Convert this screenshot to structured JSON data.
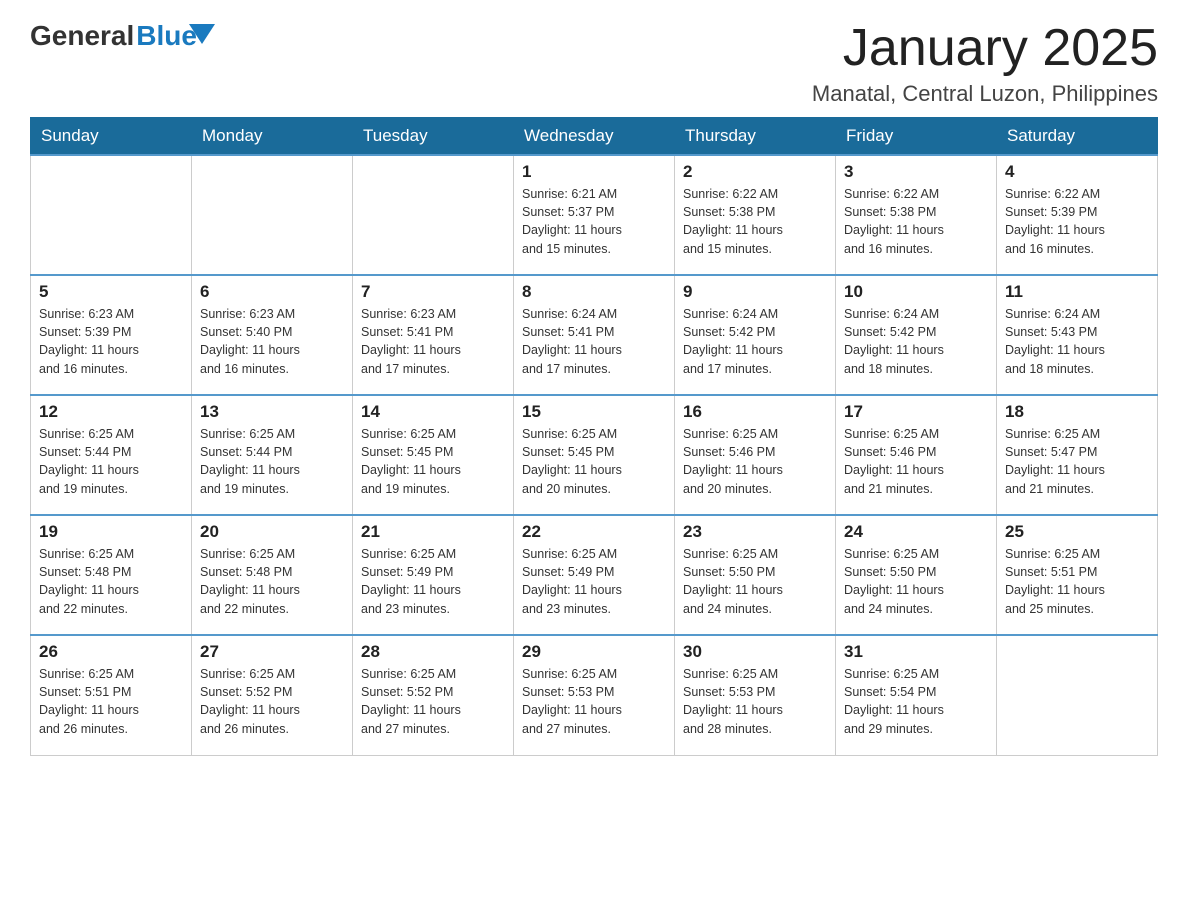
{
  "header": {
    "logo_general": "General",
    "logo_blue": "Blue",
    "month_title": "January 2025",
    "location": "Manatal, Central Luzon, Philippines"
  },
  "weekdays": [
    "Sunday",
    "Monday",
    "Tuesday",
    "Wednesday",
    "Thursday",
    "Friday",
    "Saturday"
  ],
  "weeks": [
    [
      {
        "day": "",
        "info": ""
      },
      {
        "day": "",
        "info": ""
      },
      {
        "day": "",
        "info": ""
      },
      {
        "day": "1",
        "info": "Sunrise: 6:21 AM\nSunset: 5:37 PM\nDaylight: 11 hours\nand 15 minutes."
      },
      {
        "day": "2",
        "info": "Sunrise: 6:22 AM\nSunset: 5:38 PM\nDaylight: 11 hours\nand 15 minutes."
      },
      {
        "day": "3",
        "info": "Sunrise: 6:22 AM\nSunset: 5:38 PM\nDaylight: 11 hours\nand 16 minutes."
      },
      {
        "day": "4",
        "info": "Sunrise: 6:22 AM\nSunset: 5:39 PM\nDaylight: 11 hours\nand 16 minutes."
      }
    ],
    [
      {
        "day": "5",
        "info": "Sunrise: 6:23 AM\nSunset: 5:39 PM\nDaylight: 11 hours\nand 16 minutes."
      },
      {
        "day": "6",
        "info": "Sunrise: 6:23 AM\nSunset: 5:40 PM\nDaylight: 11 hours\nand 16 minutes."
      },
      {
        "day": "7",
        "info": "Sunrise: 6:23 AM\nSunset: 5:41 PM\nDaylight: 11 hours\nand 17 minutes."
      },
      {
        "day": "8",
        "info": "Sunrise: 6:24 AM\nSunset: 5:41 PM\nDaylight: 11 hours\nand 17 minutes."
      },
      {
        "day": "9",
        "info": "Sunrise: 6:24 AM\nSunset: 5:42 PM\nDaylight: 11 hours\nand 17 minutes."
      },
      {
        "day": "10",
        "info": "Sunrise: 6:24 AM\nSunset: 5:42 PM\nDaylight: 11 hours\nand 18 minutes."
      },
      {
        "day": "11",
        "info": "Sunrise: 6:24 AM\nSunset: 5:43 PM\nDaylight: 11 hours\nand 18 minutes."
      }
    ],
    [
      {
        "day": "12",
        "info": "Sunrise: 6:25 AM\nSunset: 5:44 PM\nDaylight: 11 hours\nand 19 minutes."
      },
      {
        "day": "13",
        "info": "Sunrise: 6:25 AM\nSunset: 5:44 PM\nDaylight: 11 hours\nand 19 minutes."
      },
      {
        "day": "14",
        "info": "Sunrise: 6:25 AM\nSunset: 5:45 PM\nDaylight: 11 hours\nand 19 minutes."
      },
      {
        "day": "15",
        "info": "Sunrise: 6:25 AM\nSunset: 5:45 PM\nDaylight: 11 hours\nand 20 minutes."
      },
      {
        "day": "16",
        "info": "Sunrise: 6:25 AM\nSunset: 5:46 PM\nDaylight: 11 hours\nand 20 minutes."
      },
      {
        "day": "17",
        "info": "Sunrise: 6:25 AM\nSunset: 5:46 PM\nDaylight: 11 hours\nand 21 minutes."
      },
      {
        "day": "18",
        "info": "Sunrise: 6:25 AM\nSunset: 5:47 PM\nDaylight: 11 hours\nand 21 minutes."
      }
    ],
    [
      {
        "day": "19",
        "info": "Sunrise: 6:25 AM\nSunset: 5:48 PM\nDaylight: 11 hours\nand 22 minutes."
      },
      {
        "day": "20",
        "info": "Sunrise: 6:25 AM\nSunset: 5:48 PM\nDaylight: 11 hours\nand 22 minutes."
      },
      {
        "day": "21",
        "info": "Sunrise: 6:25 AM\nSunset: 5:49 PM\nDaylight: 11 hours\nand 23 minutes."
      },
      {
        "day": "22",
        "info": "Sunrise: 6:25 AM\nSunset: 5:49 PM\nDaylight: 11 hours\nand 23 minutes."
      },
      {
        "day": "23",
        "info": "Sunrise: 6:25 AM\nSunset: 5:50 PM\nDaylight: 11 hours\nand 24 minutes."
      },
      {
        "day": "24",
        "info": "Sunrise: 6:25 AM\nSunset: 5:50 PM\nDaylight: 11 hours\nand 24 minutes."
      },
      {
        "day": "25",
        "info": "Sunrise: 6:25 AM\nSunset: 5:51 PM\nDaylight: 11 hours\nand 25 minutes."
      }
    ],
    [
      {
        "day": "26",
        "info": "Sunrise: 6:25 AM\nSunset: 5:51 PM\nDaylight: 11 hours\nand 26 minutes."
      },
      {
        "day": "27",
        "info": "Sunrise: 6:25 AM\nSunset: 5:52 PM\nDaylight: 11 hours\nand 26 minutes."
      },
      {
        "day": "28",
        "info": "Sunrise: 6:25 AM\nSunset: 5:52 PM\nDaylight: 11 hours\nand 27 minutes."
      },
      {
        "day": "29",
        "info": "Sunrise: 6:25 AM\nSunset: 5:53 PM\nDaylight: 11 hours\nand 27 minutes."
      },
      {
        "day": "30",
        "info": "Sunrise: 6:25 AM\nSunset: 5:53 PM\nDaylight: 11 hours\nand 28 minutes."
      },
      {
        "day": "31",
        "info": "Sunrise: 6:25 AM\nSunset: 5:54 PM\nDaylight: 11 hours\nand 29 minutes."
      },
      {
        "day": "",
        "info": ""
      }
    ]
  ]
}
